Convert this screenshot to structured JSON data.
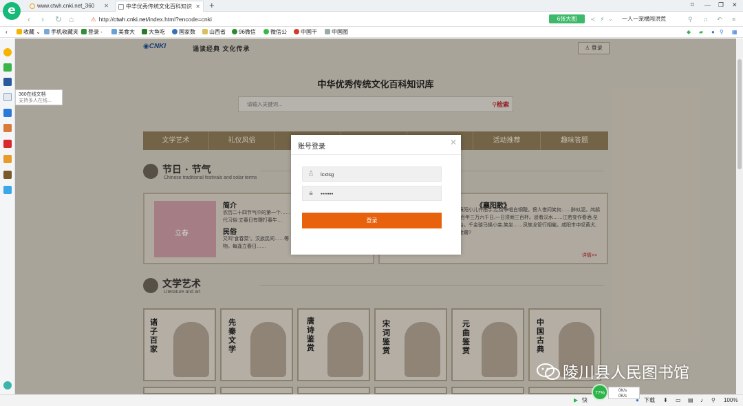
{
  "browser": {
    "tabs": [
      {
        "title": "www.ctwh.cnki.net_360",
        "active": false
      },
      {
        "title": "中华优秀传统文化百科知识",
        "active": true
      }
    ],
    "address": {
      "prefix": "http://",
      "host": "ctwh.cnki.net",
      "path": "/index.html?encode=cnki"
    },
    "snapshot_label": "6张大图",
    "search_hint": "一人一宠横闯洪荒",
    "bookmarks": [
      "收藏",
      "手机收藏夹",
      "登录 -",
      "美食大",
      "大鱼吃",
      "国家数",
      "山西省",
      "96微信",
      "微信公",
      "中国干",
      "中国图"
    ],
    "sidebar_tooltip": {
      "title": "360在线文档",
      "subtitle": "支持多人在线..."
    },
    "status": {
      "quick_label": "快",
      "download": "下载",
      "zoom": "100%",
      "gauge": "77%",
      "speed_up": "0K/s",
      "speed_down": "0K/s"
    }
  },
  "site": {
    "slogan": "诵读经典 文化传承",
    "login_button": "登录",
    "title": "中华优秀传统文化百科知识库",
    "search_placeholder": "请输入关键词...",
    "search_button": "检索",
    "nav": [
      "文学艺术",
      "礼仪风俗",
      "",
      "",
      "",
      "活动推荐",
      "趣味答题"
    ],
    "festival": {
      "title": "节日 · 节气",
      "subtitle": "Chinese traditional festivals and solar terms",
      "intro_heading": "简介",
      "intro_text": "农历二十四节气中的第一个……代习俗:立春日有鞭打春牛…",
      "custom_heading": "民俗",
      "custom_text": "又叫\"食春菜\"。汉族民间……等物。每逢立春日……",
      "image_label": "立春",
      "poem_title": "《襄阳歌》",
      "poem_text": "……下迷。襄阳小儿齐拍手,拦街争唱白铜鞮。傍人借问笑何……醉似泥。鸬鹚杓,鹦鹉杯。百年三万六千日,一日须倾三百杯。遥看汉水……江若变作春酒,垒麴便筑糟丘台。千金骏马换小妾,笑坐……凤笙龙管行相催。咸阳市中叹黄犬,何如月下倾金罍?",
      "more": "详情>>"
    },
    "literature": {
      "title": "文学艺术",
      "subtitle": "Literature and art",
      "cards": [
        "诸子百家",
        "先秦文学",
        "唐诗鉴赏",
        "宋词鉴赏",
        "元曲鉴赏",
        "中国古典"
      ]
    }
  },
  "modal": {
    "title": "账号登录",
    "username": "lcxtsg",
    "password": "•••••••",
    "submit": "登录"
  },
  "watermark": "陵川县人民图书馆"
}
